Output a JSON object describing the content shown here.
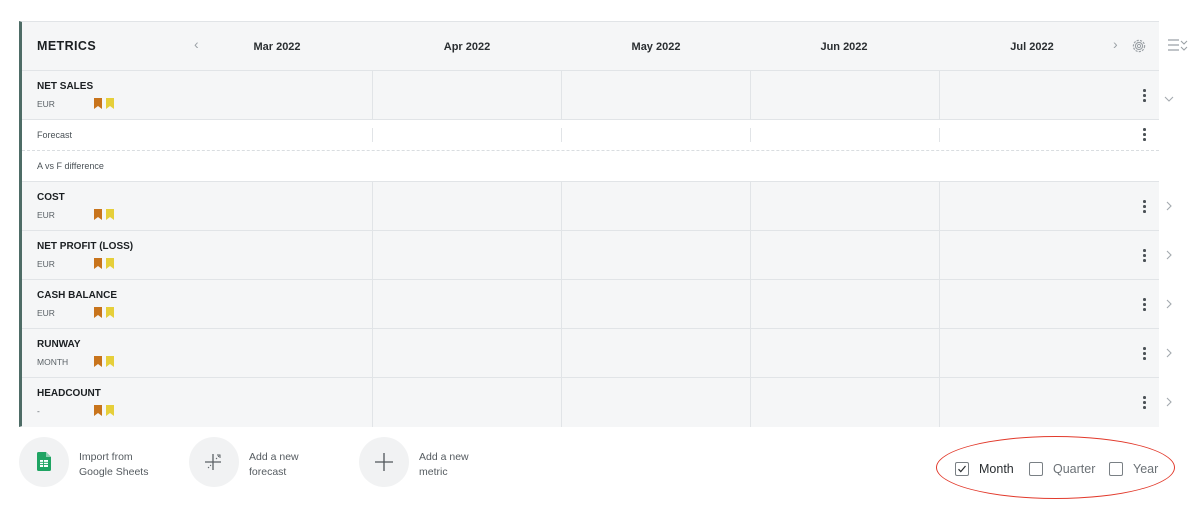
{
  "header": {
    "title": "METRICS",
    "months": [
      "Mar 2022",
      "Apr 2022",
      "May 2022",
      "Jun 2022",
      "Jul 2022"
    ],
    "prev_icon": "‹",
    "next_icon": "›"
  },
  "metrics": [
    {
      "name": "NET SALES",
      "unit": "EUR"
    },
    {
      "name": "COST",
      "unit": "EUR"
    },
    {
      "name": "NET PROFIT (LOSS)",
      "unit": "EUR"
    },
    {
      "name": "CASH BALANCE",
      "unit": "EUR"
    },
    {
      "name": "RUNWAY",
      "unit": "MONTH"
    },
    {
      "name": "HEADCOUNT",
      "unit": "-"
    }
  ],
  "sub_rows": {
    "forecast": "Forecast",
    "difference": "A vs F difference"
  },
  "actions": [
    {
      "line1": "Import from",
      "line2": "Google Sheets",
      "icon": "google-sheets-icon"
    },
    {
      "line1": "Add a new",
      "line2": "forecast",
      "icon": "forecast-plus-icon"
    },
    {
      "line1": "Add a new",
      "line2": "metric",
      "icon": "plus-icon"
    }
  ],
  "period": {
    "month": {
      "label": "Month",
      "checked": true
    },
    "quarter": {
      "label": "Quarter",
      "checked": false
    },
    "year": {
      "label": "Year",
      "checked": false
    }
  },
  "colors": {
    "accent_bar": "#4e6c66",
    "flag_actual": "#c8741c",
    "flag_forecast": "#e6cf3a",
    "sheets_green": "#1fa463",
    "highlight": "#e23a2c"
  }
}
